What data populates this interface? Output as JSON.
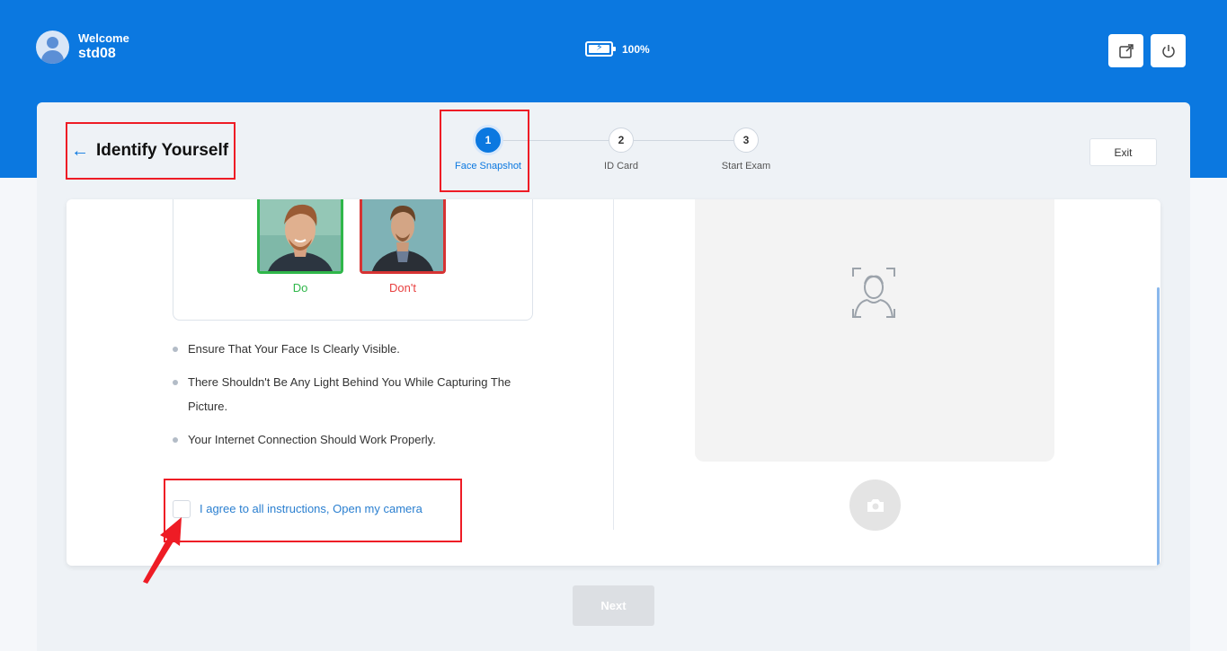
{
  "header": {
    "welcome_label": "Welcome",
    "username": "std08",
    "battery_percent_label": "100%",
    "battery_level": 1.0,
    "brand_color": "#0b78e0"
  },
  "page": {
    "title": "Identify Yourself",
    "exit_label": "Exit"
  },
  "steps": [
    {
      "number": "1",
      "label": "Face Snapshot",
      "active": true
    },
    {
      "number": "2",
      "label": "ID Card",
      "active": false
    },
    {
      "number": "3",
      "label": "Start Exam",
      "active": false
    }
  ],
  "examples": {
    "do_label": "Do",
    "dont_label": "Don't"
  },
  "instructions": [
    "Ensure That Your Face Is Clearly Visible.",
    "There Shouldn't Be Any Light Behind You While Capturing The Picture.",
    "Your Internet Connection Should Work Properly."
  ],
  "agreement": {
    "label": "I agree to all instructions, Open my camera",
    "checked": false
  },
  "footer": {
    "next_label": "Next"
  },
  "icons": {
    "back": "arrow-left-icon",
    "battery": "battery-icon",
    "external": "external-link-icon",
    "power": "power-icon",
    "face_placeholder": "face-scan-icon",
    "camera": "camera-icon"
  }
}
